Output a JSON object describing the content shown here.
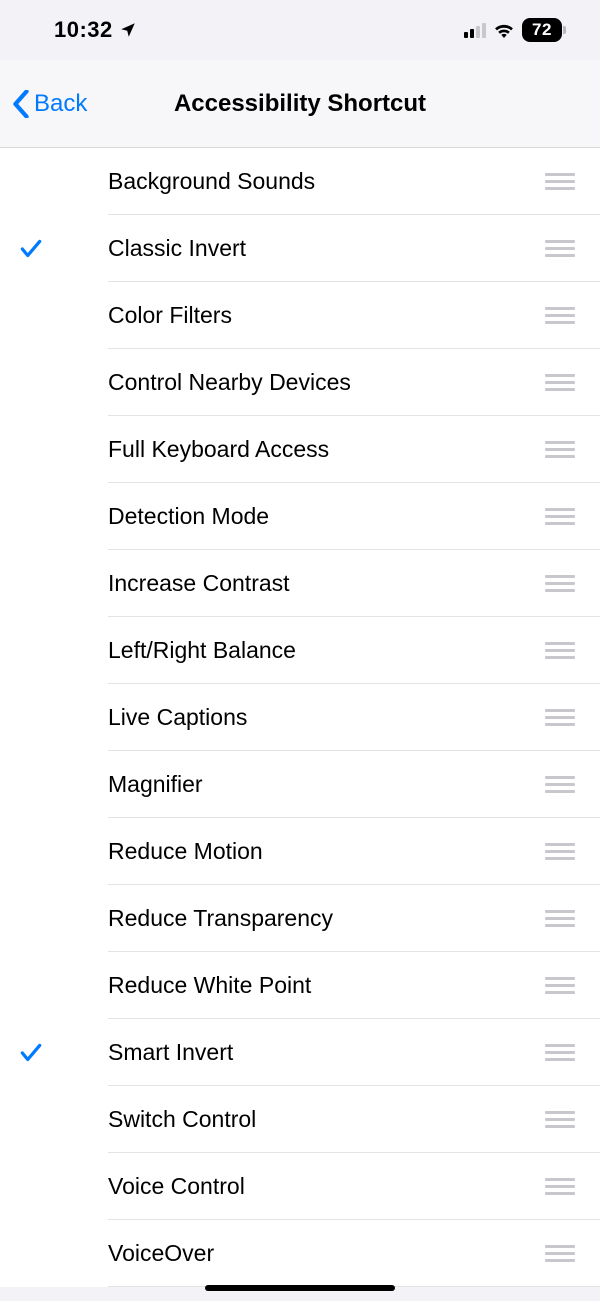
{
  "status": {
    "time": "10:32",
    "battery": "72"
  },
  "nav": {
    "back": "Back",
    "title": "Accessibility Shortcut"
  },
  "items": [
    {
      "label": "Background Sounds",
      "checked": false
    },
    {
      "label": "Classic Invert",
      "checked": true
    },
    {
      "label": "Color Filters",
      "checked": false
    },
    {
      "label": "Control Nearby Devices",
      "checked": false
    },
    {
      "label": "Full Keyboard Access",
      "checked": false
    },
    {
      "label": "Detection Mode",
      "checked": false
    },
    {
      "label": "Increase Contrast",
      "checked": false
    },
    {
      "label": "Left/Right Balance",
      "checked": false
    },
    {
      "label": "Live Captions",
      "checked": false
    },
    {
      "label": "Magnifier",
      "checked": false
    },
    {
      "label": "Reduce Motion",
      "checked": false
    },
    {
      "label": "Reduce Transparency",
      "checked": false
    },
    {
      "label": "Reduce White Point",
      "checked": false
    },
    {
      "label": "Smart Invert",
      "checked": true
    },
    {
      "label": "Switch Control",
      "checked": false
    },
    {
      "label": "Voice Control",
      "checked": false
    },
    {
      "label": "VoiceOver",
      "checked": false
    }
  ]
}
